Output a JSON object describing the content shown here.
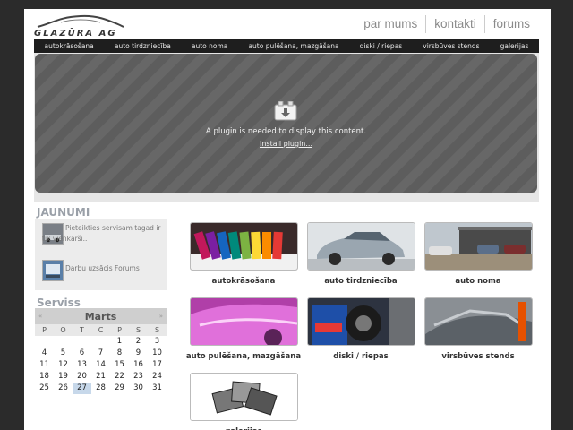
{
  "brand": {
    "logo_text": "GLAZŪRA AG"
  },
  "top_nav": [
    "par mums",
    "kontakti",
    "forums"
  ],
  "main_nav": [
    "autokrāsošana",
    "auto tirdzniecība",
    "auto noma",
    "auto pulēšana, mazgāšana",
    "diski / riepas",
    "virsbūves stends",
    "galerijas"
  ],
  "plugin": {
    "message": "A plugin is needed to display this content.",
    "install_link": "Install plugin..."
  },
  "news": {
    "title": "JAUNUMI",
    "items": [
      {
        "text": "Pieteikties servisam tagad ir tik vienkārši.."
      },
      {
        "text": "Darbu uzsācis Forums"
      }
    ]
  },
  "service": {
    "title": "Serviss",
    "calendar": {
      "month": "Marts",
      "prev": "«",
      "next": "»",
      "weekdays": [
        "P",
        "O",
        "T",
        "C",
        "P",
        "S",
        "S"
      ],
      "today": "27",
      "cells": [
        "",
        "",
        "",
        "",
        "1",
        "2",
        "3",
        "4",
        "5",
        "6",
        "7",
        "8",
        "9",
        "10",
        "11",
        "12",
        "13",
        "14",
        "15",
        "16",
        "17",
        "18",
        "19",
        "20",
        "21",
        "22",
        "23",
        "24",
        "25",
        "26",
        "27",
        "28",
        "29",
        "30",
        "31"
      ]
    }
  },
  "services": [
    {
      "label": "autokrāsošana"
    },
    {
      "label": "auto tirdzniecība"
    },
    {
      "label": "auto noma"
    },
    {
      "label": "auto pulēšana, mazgāšana"
    },
    {
      "label": "diski / riepas"
    },
    {
      "label": "virsbūves stends"
    },
    {
      "label": "galerijas"
    }
  ]
}
